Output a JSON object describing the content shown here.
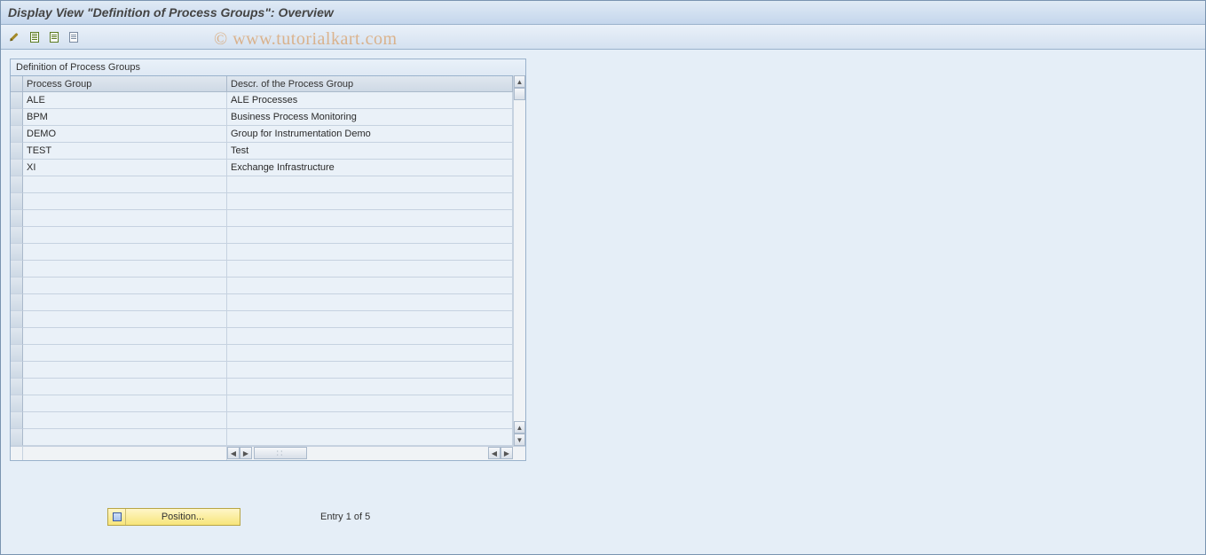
{
  "title": "Display View \"Definition of Process Groups\": Overview",
  "watermark": "© www.tutorialkart.com",
  "panel": {
    "caption": "Definition of Process Groups",
    "columns": [
      "Process Group",
      "Descr. of the Process Group"
    ],
    "rows": [
      {
        "group": "ALE",
        "descr": "ALE Processes"
      },
      {
        "group": "BPM",
        "descr": "Business Process Monitoring"
      },
      {
        "group": "DEMO",
        "descr": "Group for Instrumentation Demo"
      },
      {
        "group": "TEST",
        "descr": "Test"
      },
      {
        "group": "XI",
        "descr": "Exchange Infrastructure"
      },
      {
        "group": "",
        "descr": ""
      },
      {
        "group": "",
        "descr": ""
      },
      {
        "group": "",
        "descr": ""
      },
      {
        "group": "",
        "descr": ""
      },
      {
        "group": "",
        "descr": ""
      },
      {
        "group": "",
        "descr": ""
      },
      {
        "group": "",
        "descr": ""
      },
      {
        "group": "",
        "descr": ""
      },
      {
        "group": "",
        "descr": ""
      },
      {
        "group": "",
        "descr": ""
      },
      {
        "group": "",
        "descr": ""
      },
      {
        "group": "",
        "descr": ""
      },
      {
        "group": "",
        "descr": ""
      },
      {
        "group": "",
        "descr": ""
      },
      {
        "group": "",
        "descr": ""
      },
      {
        "group": "",
        "descr": ""
      }
    ]
  },
  "footer": {
    "position_label": "Position...",
    "entry_text": "Entry 1 of 5"
  }
}
